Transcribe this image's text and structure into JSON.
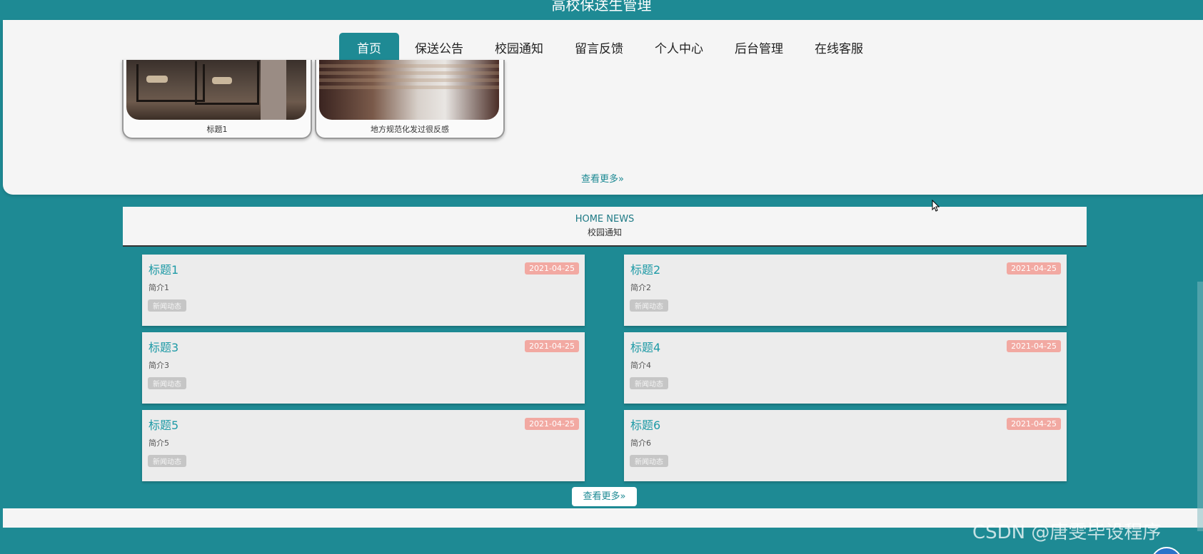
{
  "site": {
    "title": "高校保送生管理"
  },
  "nav": {
    "items": [
      {
        "label": "首页",
        "active": true
      },
      {
        "label": "保送公告"
      },
      {
        "label": "校园通知"
      },
      {
        "label": "留言反馈"
      },
      {
        "label": "个人中心"
      },
      {
        "label": "后台管理"
      },
      {
        "label": "在线客服"
      }
    ]
  },
  "announcements": {
    "cards": [
      {
        "caption": "标题1"
      },
      {
        "caption": "地方规范化发过很反感"
      }
    ],
    "more_label": "查看更多»"
  },
  "news": {
    "header_en": "HOME NEWS",
    "header_zh": "校园通知",
    "items": [
      {
        "title": "标题1",
        "date": "2021-04-25",
        "brief": "简介1",
        "tag": "新闻动态"
      },
      {
        "title": "标题2",
        "date": "2021-04-25",
        "brief": "简介2",
        "tag": "新闻动态"
      },
      {
        "title": "标题3",
        "date": "2021-04-25",
        "brief": "简介3",
        "tag": "新闻动态"
      },
      {
        "title": "标题4",
        "date": "2021-04-25",
        "brief": "简介4",
        "tag": "新闻动态"
      },
      {
        "title": "标题5",
        "date": "2021-04-25",
        "brief": "简介5",
        "tag": "新闻动态"
      },
      {
        "title": "标题6",
        "date": "2021-04-25",
        "brief": "简介6",
        "tag": "新闻动态"
      }
    ],
    "more_label": "查看更多»"
  },
  "watermark": "CSDN @唐雯毕设程序",
  "colors": {
    "primary": "#1e8a94",
    "date_badge": "#f2a9a2",
    "title_text": "#1e9aa6"
  }
}
